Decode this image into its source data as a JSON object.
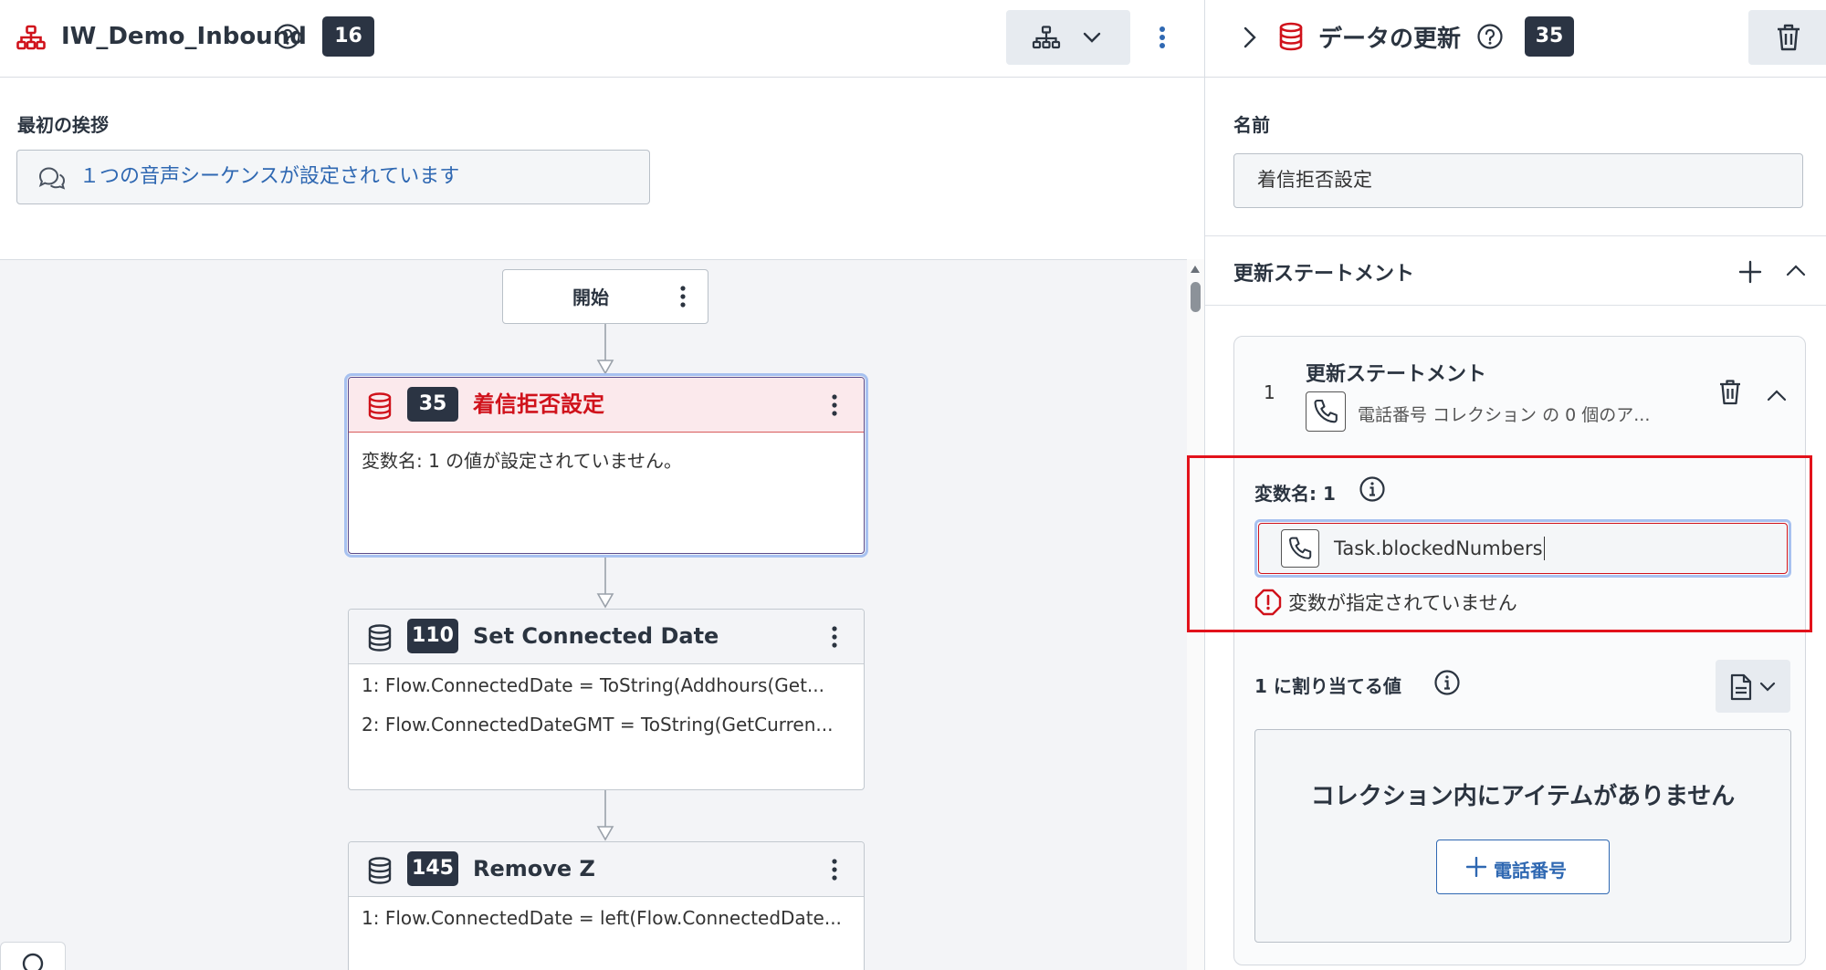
{
  "colors": {
    "accent_blue": "#2f68b2",
    "error_red": "#d0121b",
    "badge_bg": "#2b3443",
    "highlight_red": "#e2121b"
  },
  "left": {
    "flow_title": "IW_Demo_Inbound",
    "flow_badge": "16",
    "icons": {
      "flow": "org-chart-icon",
      "help": "question-circle-icon",
      "layout": "hierarchy-icon",
      "layout_chevron": "chevron-down-icon",
      "more": "kebab-vertical-icon"
    },
    "greeting": {
      "label": "最初の挨拶",
      "value": "１つの音声シーケンスが設定されています",
      "icon": "chat-bubbles-icon"
    },
    "start_node": {
      "label": "開始"
    },
    "nodes": [
      {
        "badge": "35",
        "title": "着信拒否設定",
        "lines": [
          "変数名: 1 の値が設定されていません。"
        ],
        "state": "error-selected"
      },
      {
        "badge": "110",
        "title": "Set Connected Date",
        "lines": [
          "1: Flow.ConnectedDate = ToString(Addhours(Get...",
          "2: Flow.ConnectedDateGMT = ToString(GetCurren..."
        ]
      },
      {
        "badge": "145",
        "title": "Remove Z",
        "lines": [
          "1: Flow.ConnectedDate = left(Flow.ConnectedDate..."
        ]
      }
    ]
  },
  "right": {
    "title": "データの更新",
    "badge": "35",
    "icons": {
      "collapse": "chevron-right-icon",
      "type": "database-icon",
      "help": "question-circle-icon",
      "delete": "trash-icon"
    },
    "name_label": "名前",
    "name_value": "着信拒否設定",
    "statements_section_label": "更新ステートメント",
    "statement": {
      "index": "1",
      "title": "更新ステートメント",
      "description": "電話番号 コレクション の 0 個のア...",
      "variable_label": "変数名: 1",
      "variable_value": "Task.blockedNumbers",
      "error_message": "変数が指定されていません",
      "assign_label": "1 に割り当てる値",
      "empty_message": "コレクション内にアイテムがありません",
      "add_button_label": "電話番号"
    }
  }
}
